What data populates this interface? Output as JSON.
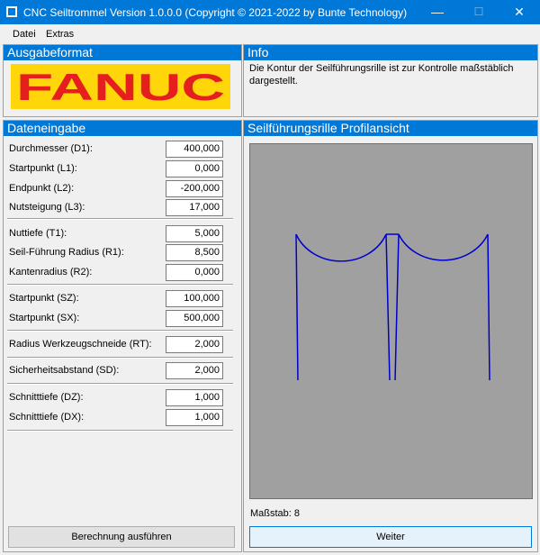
{
  "window": {
    "title": "CNC Seiltrommel Version 1.0.0.0 (Copyright ©  2021-2022 by Bunte Technology)"
  },
  "menu": [
    "Datei",
    "Extras"
  ],
  "ausgabeformat": {
    "header": "Ausgabeformat",
    "logo_text": "FANUC",
    "logo_bg": "#ffd60a",
    "logo_fg": "#e51e1e"
  },
  "info": {
    "header": "Info",
    "text": "Die Kontur der Seilführungsrille ist zur Kontrolle maßstäblich dargestellt."
  },
  "dateneingabe": {
    "header": "Dateneingabe",
    "fields": [
      {
        "label": "Durchmesser (D1):",
        "value": "400,000"
      },
      {
        "label": "Startpunkt (L1):",
        "value": "0,000"
      },
      {
        "label": "Endpunkt (L2):",
        "value": "-200,000"
      },
      {
        "label": "Nutsteigung (L3):",
        "value": "17,000"
      },
      {
        "label": "Nuttiefe (T1):",
        "value": "5,000"
      },
      {
        "label": "Seil-Führung Radius (R1):",
        "value": "8,500"
      },
      {
        "label": "Kantenradius (R2):",
        "value": "0,000"
      },
      {
        "label": "Startpunkt (SZ):",
        "value": "100,000"
      },
      {
        "label": "Startpunkt (SX):",
        "value": "500,000"
      },
      {
        "label": "Radius Werkzeugschneide (RT):",
        "value": "2,000"
      },
      {
        "label": "Sicherheitsabstand (SD):",
        "value": "2,000"
      },
      {
        "label": "Schnitttiefe (DZ):",
        "value": "1,000"
      },
      {
        "label": "Schnitttiefe (DX):",
        "value": "1,000"
      }
    ],
    "button": "Berechnung ausführen"
  },
  "profil": {
    "header": "Seilführungsrille Profilansicht",
    "scale_label": "Maßstab: 8",
    "line_color": "#0000cc",
    "canvas_bg": "#a0a0a0"
  },
  "weiter_button": "Weiter",
  "colors": {
    "accent": "#0078d7"
  }
}
